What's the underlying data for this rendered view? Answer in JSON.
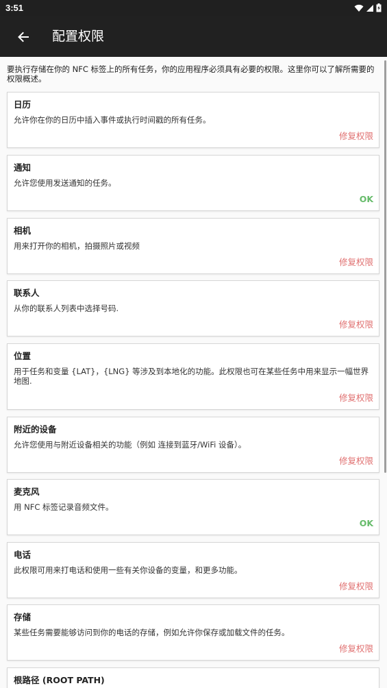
{
  "status_bar": {
    "time": "3:51",
    "icons": [
      "wifi-icon",
      "signal-icon",
      "battery-icon"
    ]
  },
  "app_bar": {
    "back_icon": "arrow-left-icon",
    "title": "配置权限"
  },
  "intro": "要执行存储在你的 NFC 标签上的所有任务，你的应用程序必须具有必要的权限。这里你可以了解所需要的权限概述。",
  "colors": {
    "status_bar": "#202020",
    "app_bar": "#212121",
    "fix_action": "#e07070",
    "ok_action": "#66bb6a"
  },
  "permissions": [
    {
      "title": "日历",
      "desc": "允许你在你的日历中插入事件或执行时间戳的所有任务。",
      "action": "修复权限",
      "status": "fix"
    },
    {
      "title": "通知",
      "desc": "允许您使用发送通知的任务。",
      "action": "OK",
      "status": "ok"
    },
    {
      "title": "相机",
      "desc": "用来打开你的相机，拍摄照片或视频",
      "action": "修复权限",
      "status": "fix"
    },
    {
      "title": "联系人",
      "desc": "从你的联系人列表中选择号码.",
      "action": "修复权限",
      "status": "fix"
    },
    {
      "title": "位置",
      "desc": "用于任务和变量 {LAT}，{LNG} 等涉及到本地化的功能。此权限也可在某些任务中用来显示一幅世界地图.",
      "action": "修复权限",
      "status": "fix"
    },
    {
      "title": "附近的设备",
      "desc": "允许您使用与附近设备相关的功能（例如 连接到蓝牙/WiFi 设备）。",
      "action": "修复权限",
      "status": "fix"
    },
    {
      "title": "麦克风",
      "desc": "用 NFC 标签记录音频文件。",
      "action": "OK",
      "status": "ok"
    },
    {
      "title": "电话",
      "desc": "此权限可用来打电话和使用一些有关你设备的变量，和更多功能。",
      "action": "修复权限",
      "status": "fix"
    },
    {
      "title": "存储",
      "desc": "某些任务需要能够访问到你的电话的存储，例如允许你保存或加载文件的任务。",
      "action": "修复权限",
      "status": "fix"
    },
    {
      "title": "根路径 (ROOT PATH)",
      "desc": "",
      "action": "",
      "status": "none"
    }
  ]
}
